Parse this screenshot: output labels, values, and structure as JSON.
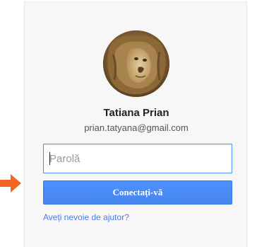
{
  "account": {
    "name": "Tatiana Prian",
    "email": "prian.tatyana@gmail.com",
    "avatar_icon": "lion-profile-photo"
  },
  "password": {
    "placeholder": "Parolă",
    "value": ""
  },
  "signin": {
    "label": "Conectați-vă"
  },
  "help": {
    "label": "Aveți nevoie de ajutor?"
  },
  "colors": {
    "accent": "#4d90fe",
    "link": "#427fed",
    "pointer_arrow": "#f26522"
  },
  "pointer": {
    "icon": "right-arrow-icon"
  }
}
